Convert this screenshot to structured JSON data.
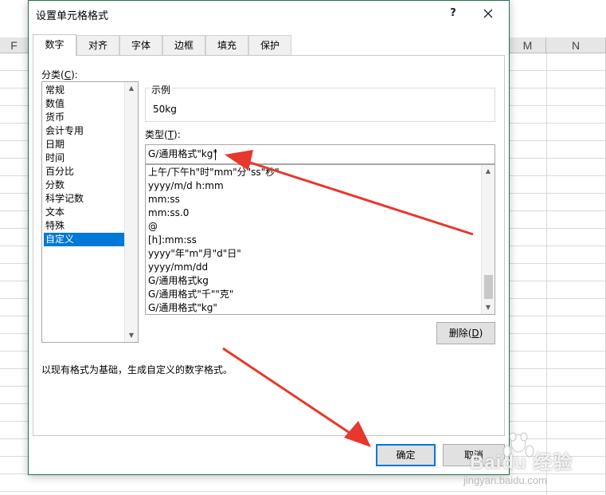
{
  "spreadsheet": {
    "columns": [
      "F",
      "M",
      "N"
    ]
  },
  "dialog": {
    "title": "设置单元格格式",
    "help_label": "?",
    "close_label": "✕",
    "tabs": [
      "数字",
      "对齐",
      "字体",
      "边框",
      "填充",
      "保护"
    ],
    "active_tab": "数字",
    "category_label": "分类(C):",
    "category_label_parts": [
      "分类(",
      "C",
      "):"
    ],
    "categories": [
      "常规",
      "数值",
      "货币",
      "会计专用",
      "日期",
      "时间",
      "百分比",
      "分数",
      "科学记数",
      "文本",
      "特殊",
      "自定义"
    ],
    "selected_category": "自定义",
    "sample_label": "示例",
    "sample_value": "50kg",
    "type_label_parts": [
      "类型(",
      "T",
      "):"
    ],
    "type_value": "G/通用格式\"kg\"",
    "format_list": [
      "上午/下午h\"时\"mm\"分\"ss\"秒\"",
      "yyyy/m/d h:mm",
      "mm:ss",
      "mm:ss.0",
      "@",
      "[h]:mm:ss",
      "yyyy\"年\"m\"月\"d\"日\"",
      "yyyy/mm/dd",
      "G/通用格式kg",
      "G/通用格式\"千\"\"克\"",
      "G/通用格式\"kg\""
    ],
    "delete_button_parts": [
      "删除(",
      "D",
      ")"
    ],
    "description": "以现有格式为基础，生成自定义的数字格式。",
    "ok_button": "确定",
    "cancel_button": "取消"
  },
  "annotation": {
    "arrow_color": "#e8372c"
  },
  "watermark": {
    "brand": "Baidu 经验",
    "url": "jingyan.baidu.com"
  }
}
